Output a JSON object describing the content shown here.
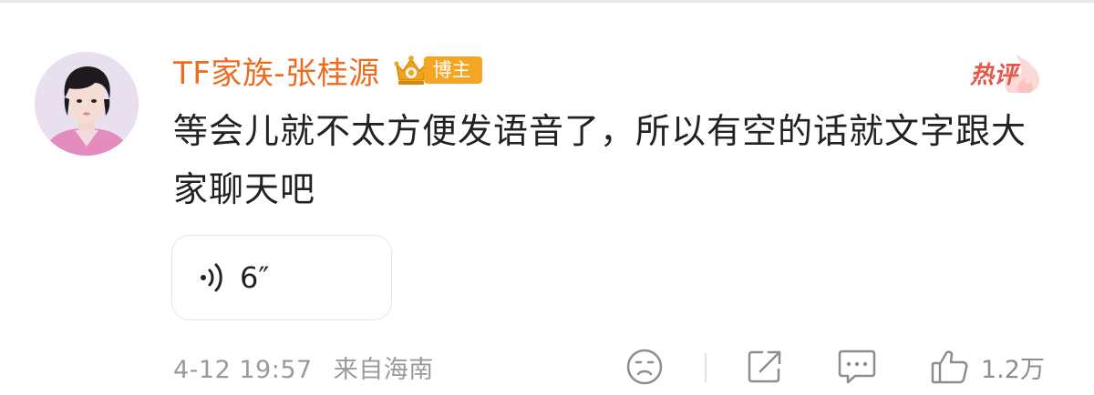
{
  "comment": {
    "username": "TF家族-张桂源",
    "badge_label": "博主",
    "hot_label": "热评",
    "text": "等会儿就不太方便发语音了，所以有空的话就文字跟大家聊天吧",
    "voice_duration": "6″",
    "date": "4-12 19:57",
    "location": "来自海南",
    "like_count": "1.2万"
  },
  "colors": {
    "username": "#f06b1e",
    "badge": "#f5a524",
    "hot": "#e8544a",
    "text": "#222222",
    "meta": "#9a9a9a"
  },
  "icons": {
    "badge": "crown-icon",
    "voice": "sound-wave-icon",
    "emoji": "sad-face-icon",
    "share": "share-icon",
    "reply": "comment-bubble-icon",
    "like": "thumbs-up-icon"
  }
}
